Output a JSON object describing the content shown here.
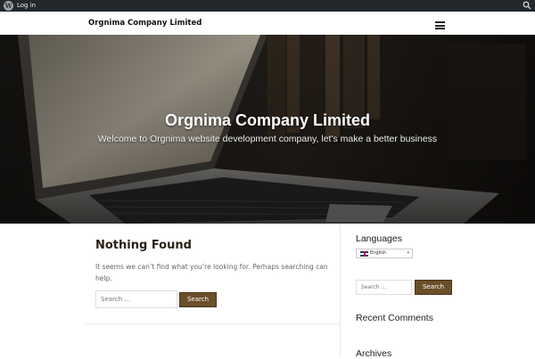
{
  "admin_bar": {
    "logo_icon": "wordpress-icon",
    "login_label": "Log in",
    "search_icon": "search-icon"
  },
  "header": {
    "site_title": "Orgnima Company Limited",
    "menu_icon": "hamburger-menu-icon"
  },
  "hero": {
    "title": "Orgnima Company Limited",
    "subtitle": "Welcome to Orgnima website development company, let's make a better business"
  },
  "main": {
    "heading": "Nothing Found",
    "message": "It seems we can’t find what you’re looking for. Perhaps searching can help.",
    "search_placeholder": "Search …",
    "search_button": "Search"
  },
  "sidebar": {
    "languages_title": "Languages",
    "language_selected": "English",
    "search_placeholder": "Search …",
    "search_button": "Search",
    "recent_comments_title": "Recent Comments",
    "archives_title": "Archives"
  },
  "colors": {
    "admin_bar": "#23282d",
    "button": "#6b4f2a",
    "heading": "#2a1f14"
  }
}
